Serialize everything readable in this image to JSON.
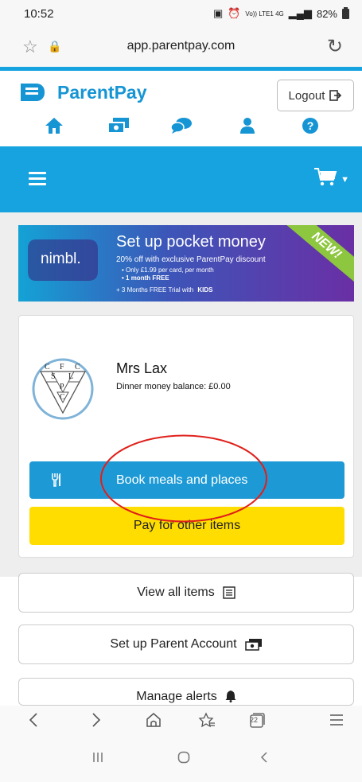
{
  "status_bar": {
    "time": "10:52",
    "network": "Vo)) LTE1 4G",
    "battery": "82%"
  },
  "browser": {
    "url": "app.parentpay.com"
  },
  "header": {
    "brand": "ParentPay",
    "logout_label": "Logout"
  },
  "nav_icons": [
    "home-icon",
    "payments-icon",
    "messages-icon",
    "account-icon",
    "help-icon"
  ],
  "promo": {
    "brand": "nimbl.",
    "title": "Set up pocket money",
    "line1": "20% off with exclusive ParentPay discount",
    "bullet1": "• Only £1.99 per card, per month",
    "bullet2": "• 1 month FREE",
    "line3": "+ 3 Months FREE Trial with",
    "partner": "KIDS",
    "ribbon": "NEW!"
  },
  "child": {
    "name": "Mrs Lax",
    "balance_text": "Dinner money balance: £0.00",
    "crest_letters": [
      "C",
      "F",
      "C",
      "S",
      "L",
      "P",
      "C"
    ]
  },
  "buttons": {
    "book_meals": "Book meals and places",
    "pay_other": "Pay for other items",
    "view_all": "View all items",
    "setup_account": "Set up Parent Account",
    "manage_alerts": "Manage alerts"
  },
  "browser_nav": {
    "tabs_count": "22"
  },
  "colors": {
    "brand_blue": "#17a3df",
    "button_blue": "#1d9ad6",
    "yellow": "#ffdd00",
    "highlight": "#e0201b"
  }
}
